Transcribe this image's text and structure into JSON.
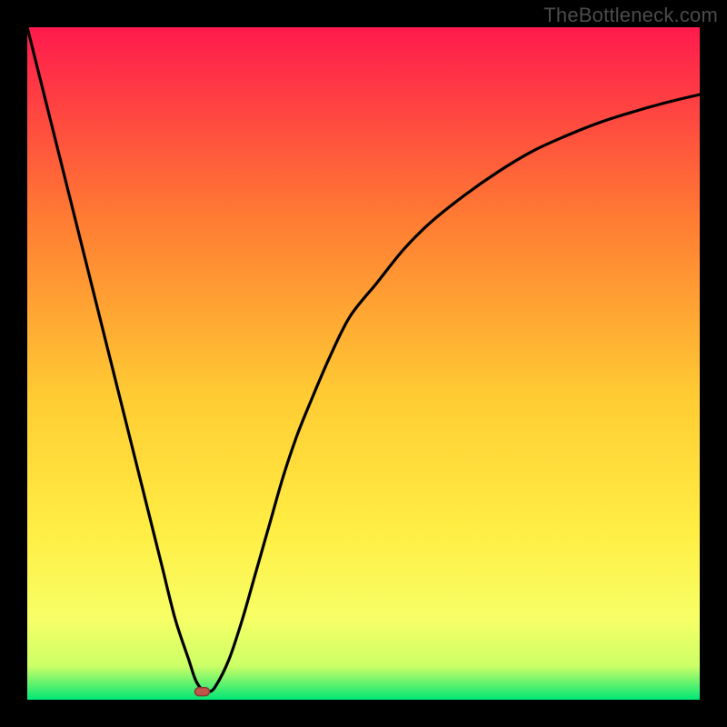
{
  "watermark": "TheBottleneck.com",
  "gradient": {
    "top": "#ff1a4d",
    "mid1": "#ff7a33",
    "mid2": "#ffcc33",
    "mid3": "#ffee44",
    "mid4": "#f7ff66",
    "low": "#ccff66",
    "bottom": "#00e676"
  },
  "curve_stroke": "#000000",
  "minimum_marker": {
    "fill": "#c1554a",
    "outline": "#8a3c34"
  },
  "chart_data": {
    "type": "line",
    "title": "",
    "xlabel": "",
    "ylabel": "",
    "xlim": [
      0,
      100
    ],
    "ylim": [
      0,
      100
    ],
    "x": [
      0,
      2,
      4,
      6,
      8,
      10,
      12,
      14,
      16,
      18,
      20,
      22,
      24,
      25,
      26,
      27,
      28,
      30,
      32,
      34,
      36,
      38,
      40,
      42,
      45,
      48,
      52,
      56,
      60,
      65,
      70,
      75,
      80,
      85,
      90,
      95,
      100
    ],
    "values": [
      100,
      92,
      84,
      76,
      68,
      60,
      52,
      44,
      36,
      28,
      20,
      12,
      6,
      3,
      1.5,
      1.2,
      2,
      6,
      12,
      19,
      26,
      33,
      39,
      44,
      51,
      57,
      62,
      67,
      71,
      75,
      78.5,
      81.5,
      83.8,
      85.8,
      87.4,
      88.8,
      90
    ],
    "minimum_point": {
      "x": 26,
      "y": 1.2
    }
  }
}
